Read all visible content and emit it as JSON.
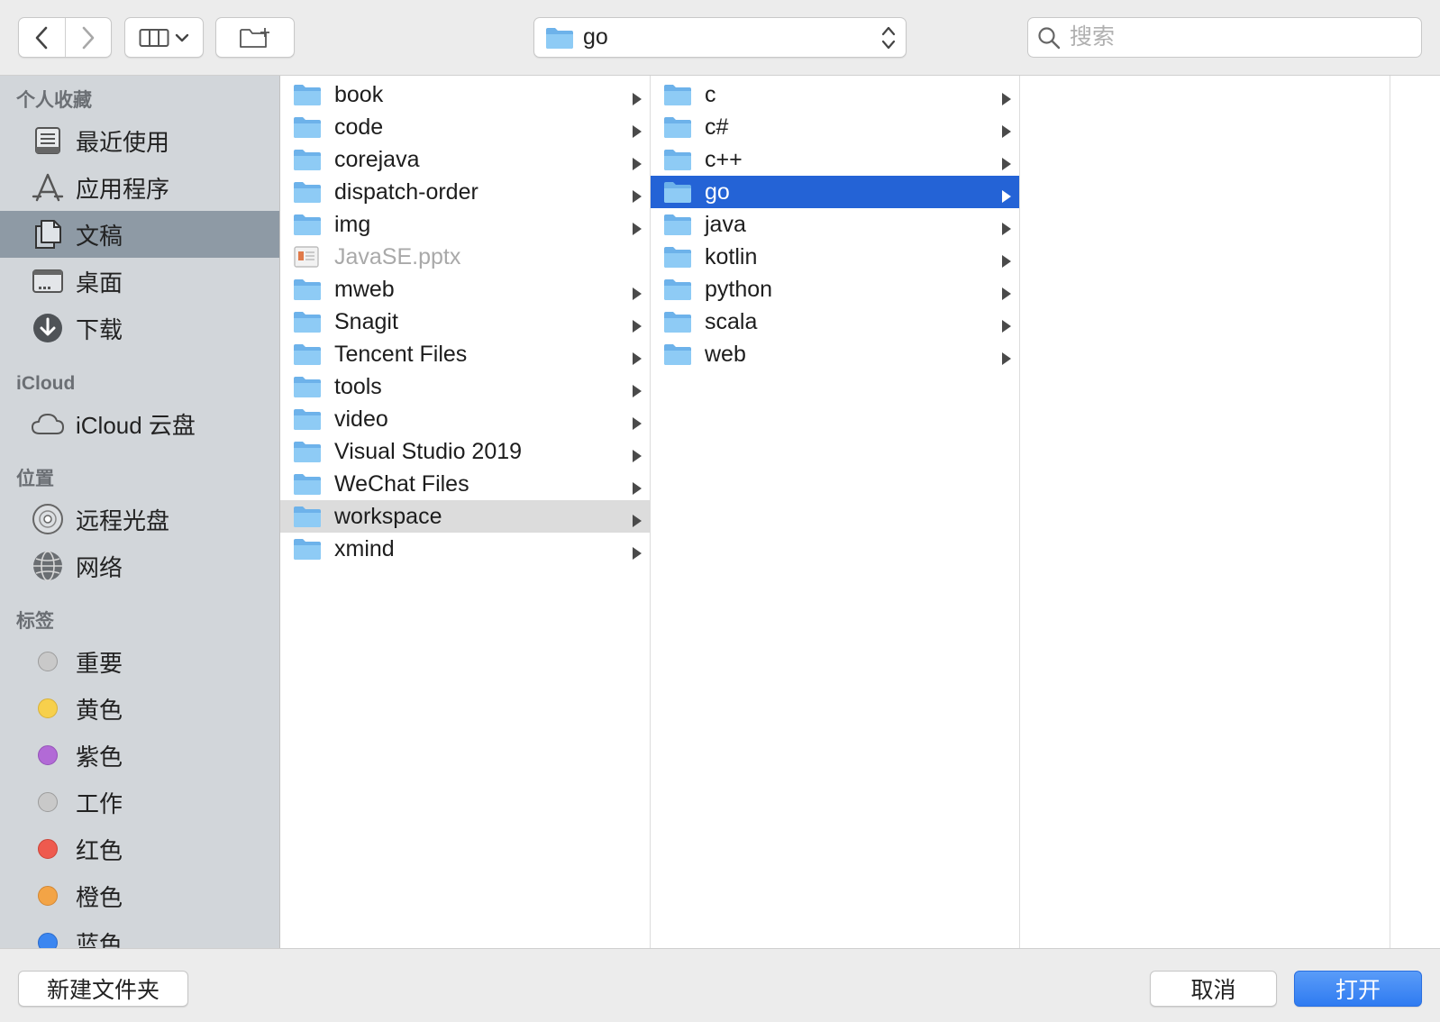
{
  "toolbar": {
    "path_label": "go",
    "search_placeholder": "搜索",
    "icons": [
      "chevron-left-icon",
      "chevron-right-icon",
      "column-view-icon",
      "chevron-down-icon",
      "new-folder-icon",
      "folder-icon",
      "updown-icon",
      "search-icon"
    ]
  },
  "sidebar": {
    "favorites_header": "个人收藏",
    "favorites": [
      {
        "label": "最近使用",
        "icon": "recents-icon"
      },
      {
        "label": "应用程序",
        "icon": "applications-icon"
      },
      {
        "label": "文稿",
        "icon": "documents-icon"
      },
      {
        "label": "桌面",
        "icon": "desktop-icon"
      },
      {
        "label": "下载",
        "icon": "downloads-icon"
      }
    ],
    "icloud_header": "iCloud",
    "icloud": [
      {
        "label": "iCloud 云盘",
        "icon": "cloud-icon"
      }
    ],
    "locations_header": "位置",
    "locations": [
      {
        "label": "远程光盘",
        "icon": "disc-icon"
      },
      {
        "label": "网络",
        "icon": "network-icon"
      }
    ],
    "tags_header": "标签",
    "tags": [
      {
        "label": "重要",
        "color": "#c9c9c9"
      },
      {
        "label": "黄色",
        "color": "#f7d04c"
      },
      {
        "label": "紫色",
        "color": "#b26ad6"
      },
      {
        "label": "工作",
        "color": "#c9c9c9"
      },
      {
        "label": "红色",
        "color": "#ee5a4e"
      },
      {
        "label": "橙色",
        "color": "#f3a446"
      },
      {
        "label": "蓝色",
        "color": "#3b86f0"
      }
    ]
  },
  "columns": {
    "col1": [
      {
        "name": "book"
      },
      {
        "name": "code"
      },
      {
        "name": "corejava"
      },
      {
        "name": "dispatch-order"
      },
      {
        "name": "img"
      },
      {
        "name": "JavaSE.pptx"
      },
      {
        "name": "mweb"
      },
      {
        "name": "Snagit"
      },
      {
        "name": "Tencent Files"
      },
      {
        "name": "tools"
      },
      {
        "name": "video"
      },
      {
        "name": "Visual Studio 2019"
      },
      {
        "name": "WeChat Files"
      },
      {
        "name": "workspace"
      },
      {
        "name": "xmind"
      }
    ],
    "col2": [
      {
        "name": "c"
      },
      {
        "name": "c#"
      },
      {
        "name": "c++"
      },
      {
        "name": "go"
      },
      {
        "name": "java"
      },
      {
        "name": "kotlin"
      },
      {
        "name": "python"
      },
      {
        "name": "scala"
      },
      {
        "name": "web"
      }
    ]
  },
  "bottom": {
    "new_folder_label": "新建文件夹",
    "cancel_label": "取消",
    "open_label": "打开"
  },
  "colors": {
    "selection_active": "#2463d6",
    "selection_inactive": "#dcdcdc",
    "sidebar_bg": "#d2d6da",
    "sidebar_selected": "#8e9aa5",
    "folder_blue": "#86c5f1",
    "open_button": "#2f7bf1"
  }
}
